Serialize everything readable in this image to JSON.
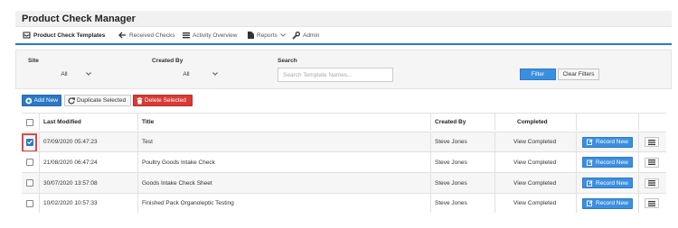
{
  "app": {
    "title": "Product Check Manager"
  },
  "tabs": [
    {
      "label": "Product Check Templates",
      "icon": "inbox-icon",
      "active": true
    },
    {
      "label": "Received Checks",
      "icon": "arrow-left-icon",
      "active": false
    },
    {
      "label": "Activity Overview",
      "icon": "list-icon",
      "active": false
    },
    {
      "label": "Reports",
      "icon": "file-icon",
      "active": false
    },
    {
      "label": "Admin",
      "icon": "wrench-icon",
      "active": false
    }
  ],
  "filters": {
    "site_label": "Site",
    "site_value": "All",
    "created_by_label": "Created By",
    "created_by_value": "All",
    "search_label": "Search",
    "search_placeholder": "Search Template Names...",
    "filter_button": "Filter",
    "clear_button": "Clear Filters"
  },
  "actions": {
    "add_new": "Add New",
    "duplicate_selected": "Duplicate Selected",
    "delete_selected": "Delete Selected"
  },
  "table": {
    "columns": [
      "Last Modified",
      "Title",
      "Created By",
      "Completed"
    ],
    "rows": [
      {
        "checked": true,
        "last_modified": "07/09/2020 05:47:23",
        "title": "Test",
        "created_by": "Steve Jones",
        "completed": "View Completed",
        "record_label": "Record New"
      },
      {
        "checked": false,
        "last_modified": "21/08/2020 06:47:24",
        "title": "Poultry Goods Intake Check",
        "created_by": "Steve Jones",
        "completed": "View Completed",
        "record_label": "Record New"
      },
      {
        "checked": false,
        "last_modified": "30/07/2020 13:57:08",
        "title": "Goods Intake Check Sheet",
        "created_by": "Steve Jones",
        "completed": "View Completed",
        "record_label": "Record New"
      },
      {
        "checked": false,
        "last_modified": "10/02/2020 10:57:33",
        "title": "Finished Pack Organoleptic Testing",
        "created_by": "Steve Jones",
        "completed": "View Completed",
        "record_label": "Record New"
      }
    ]
  },
  "colors": {
    "accent": "#2b78c5",
    "button_blue": "#3a8fe0",
    "danger": "#d83a35",
    "highlight": "#e0474c"
  }
}
